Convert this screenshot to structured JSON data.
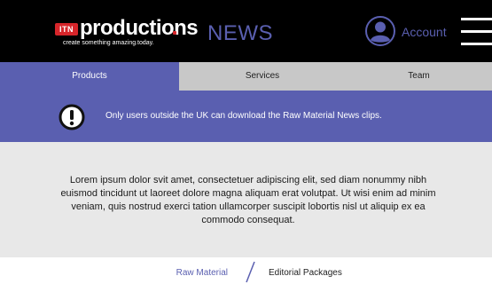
{
  "header": {
    "logo": {
      "mark": "ITN",
      "word": "productions",
      "tagline": "create something amazing.today."
    },
    "section_title": "NEWS",
    "account_label": "Account",
    "account_icon": "user-avatar-icon",
    "menu_icon": "hamburger-menu-icon"
  },
  "nav": {
    "tabs": [
      {
        "label": "Products",
        "active": true
      },
      {
        "label": "Services",
        "active": false
      },
      {
        "label": "Team",
        "active": false
      }
    ]
  },
  "notice": {
    "icon": "exclamation-circle-icon",
    "text": "Only users outside the UK can download the Raw Material News clips."
  },
  "body": {
    "text": "Lorem ipsum dolor svit amet, consectetuer adipiscing elit, sed diam nonummy nibh euismod tincidunt ut laoreet dolore magna aliquam erat volutpat. Ut wisi enim ad minim veniam, quis nostrud exerci tation ullamcorper suscipit lobortis nisl ut aliquip ex ea commodo consequat."
  },
  "sub_nav": {
    "raw_label": "Raw Material",
    "editorial_label": "Editorial Packages"
  },
  "colors": {
    "header_bg": "#000000",
    "accent": "#5a5fb0",
    "tab_bg": "#c8c8c8",
    "content_bg": "#e8e8e8",
    "logo_red": "#d6252a"
  }
}
